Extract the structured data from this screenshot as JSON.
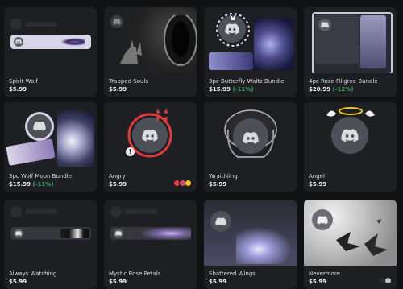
{
  "items": [
    {
      "name": "Spirit Wolf",
      "price": "$5.99",
      "discount": ""
    },
    {
      "name": "Trapped Souls",
      "price": "$5.99",
      "discount": ""
    },
    {
      "name": "3pc Butterfly Waltz Bundle",
      "price": "$15.99",
      "discount": "(-11%)"
    },
    {
      "name": "4pc Rose Filigree Bundle",
      "price": "$20.99",
      "discount": "(-12%)"
    },
    {
      "name": "3pc Wolf Moon Bundle",
      "price": "$15.99",
      "discount": "(-11%)"
    },
    {
      "name": "Angry",
      "price": "$5.99",
      "discount": ""
    },
    {
      "name": "Wraithling",
      "price": "$5.99",
      "discount": ""
    },
    {
      "name": "Angel",
      "price": "$5.99",
      "discount": ""
    },
    {
      "name": "Always Watching",
      "price": "$5.99",
      "discount": ""
    },
    {
      "name": "Mystic Rose Petals",
      "price": "$5.99",
      "discount": ""
    },
    {
      "name": "Shattered Wings",
      "price": "$5.99",
      "discount": ""
    },
    {
      "name": "Nevermore",
      "price": "$5.99",
      "discount": ""
    }
  ],
  "colors": {
    "background": "#111214",
    "card": "#1e1f22",
    "discount": "#3ba55d",
    "angry_swatches": [
      "#e03a3a",
      "#e0457b",
      "#f0c419"
    ],
    "nevermore_swatches": [
      "#2b2b2b",
      "#c2c2c2"
    ]
  },
  "icons": [
    "discord-logo-icon",
    "alert-icon",
    "halo-icon"
  ]
}
